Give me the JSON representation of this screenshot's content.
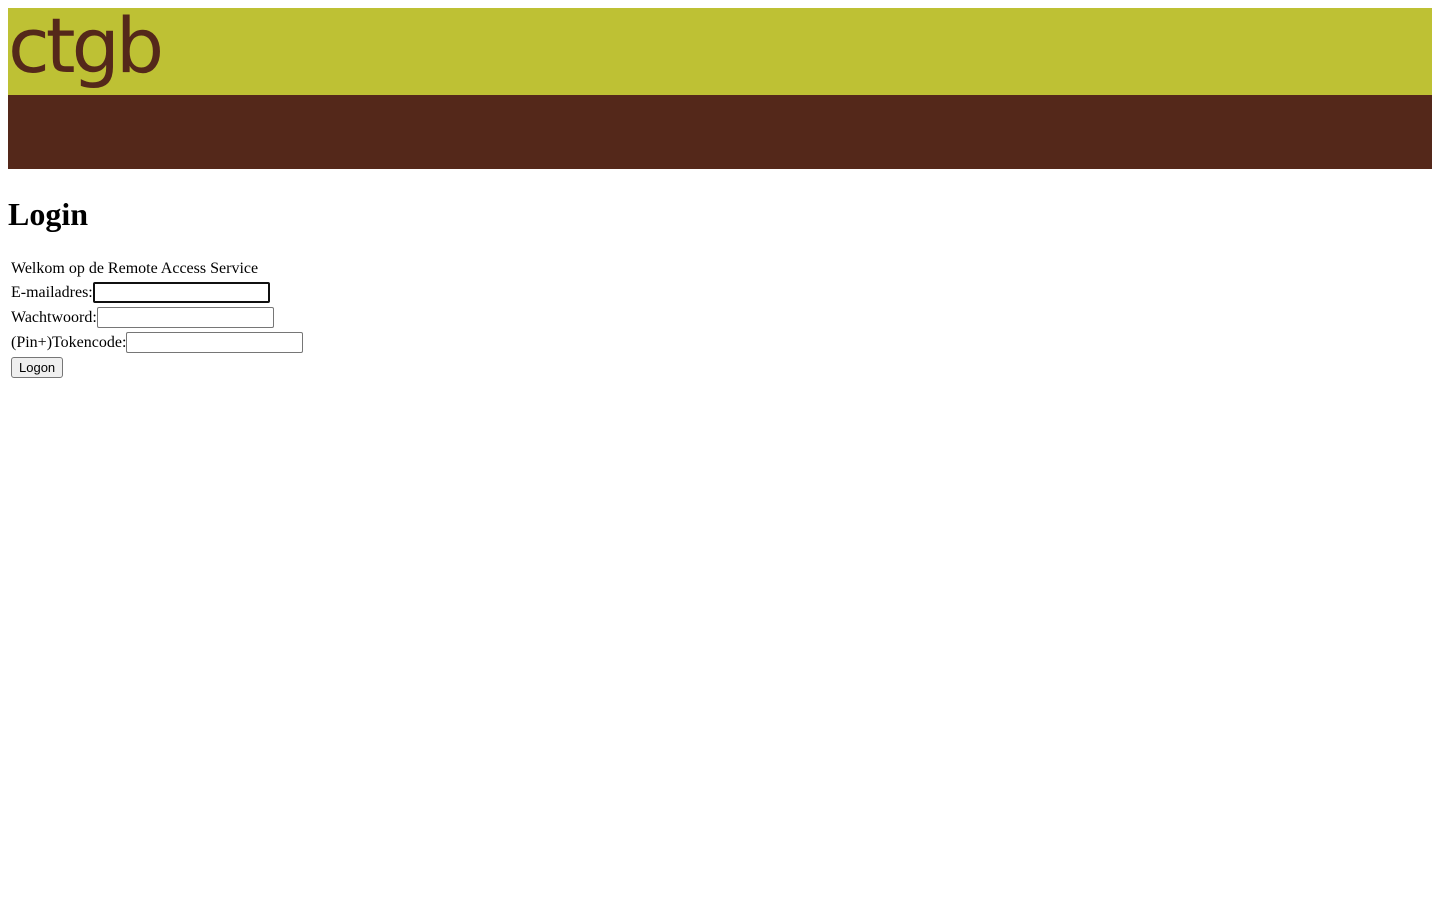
{
  "header": {
    "logo_text": "ctgb",
    "colors": {
      "top_band": "#bec134",
      "bottom_band": "#54281a",
      "logo": "#54281a"
    }
  },
  "main": {
    "title": "Login",
    "welcome_text": "Welkom op de Remote Access Service",
    "fields": {
      "email_label": "E-mailadres:",
      "email_value": "",
      "password_label": "Wachtwoord:",
      "password_value": "",
      "token_label": "(Pin+)Tokencode:",
      "token_value": ""
    },
    "logon_label": "Logon"
  }
}
